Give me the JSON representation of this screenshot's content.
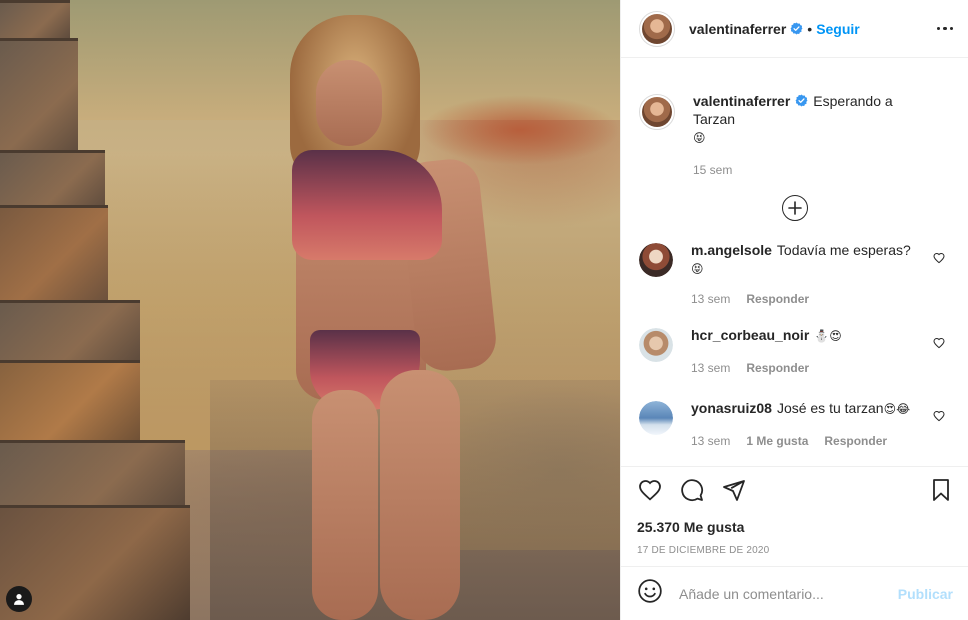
{
  "post": {
    "username": "valentinaferrer",
    "verified": true,
    "separator": "•",
    "follow_label": "Seguir",
    "caption_text": "Esperando a Tarzan",
    "caption_emoji": "😝",
    "caption_time": "15 sem",
    "likes": "25.370 Me gusta",
    "date": "17 DE DICIEMBRE DE 2020"
  },
  "comments": [
    {
      "username": "m.angelsole",
      "text": "Todavía me esperas?",
      "emoji": "😝",
      "time": "13 sem",
      "likes": "",
      "reply": "Responder"
    },
    {
      "username": "hcr_corbeau_noir",
      "text": "",
      "emoji": "⛄😍",
      "time": "13 sem",
      "likes": "",
      "reply": "Responder"
    },
    {
      "username": "yonasruiz08",
      "text": "José es tu tarzan",
      "emoji": "😍😂",
      "time": "13 sem",
      "likes": "1 Me gusta",
      "reply": "Responder"
    }
  ],
  "composer": {
    "placeholder": "Añade un comentario...",
    "publish_label": "Publicar"
  },
  "icons": {
    "verified": "verified-badge-icon",
    "more": "more-options-icon",
    "load_more": "plus-circle-icon",
    "like": "heart-icon",
    "comment": "comment-bubble-icon",
    "share": "paper-plane-icon",
    "save": "bookmark-icon",
    "emoji": "smiley-icon",
    "photo_user": "tagged-user-icon"
  },
  "colors": {
    "accent": "#0095f6",
    "verified": "#3897f0",
    "muted": "#8e8e8e",
    "publish_disabled": "#b2dffc"
  }
}
